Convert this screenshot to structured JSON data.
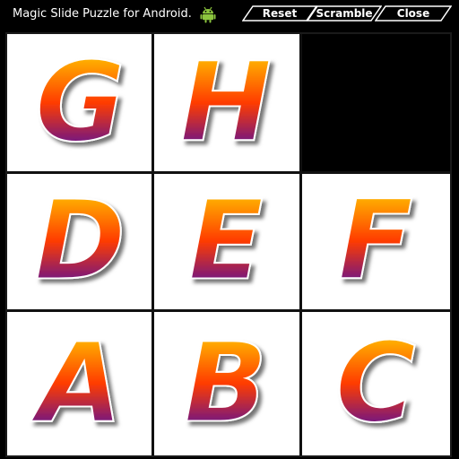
{
  "window": {
    "title": "Magic Slide Puzzle for Android.",
    "icon": "android-icon"
  },
  "toolbar": {
    "buttons": [
      {
        "id": "reset",
        "label": "Reset"
      },
      {
        "id": "scramble",
        "label": "Scramble"
      },
      {
        "id": "close",
        "label": "Close"
      }
    ]
  },
  "puzzle": {
    "rows": 3,
    "cols": 3,
    "tiles": [
      [
        "G",
        "H",
        ""
      ],
      [
        "D",
        "E",
        "F"
      ],
      [
        "A",
        "B",
        "C"
      ]
    ],
    "empty_cell": {
      "row": 0,
      "col": 2
    }
  },
  "colors": {
    "background": "#000000",
    "board": "#ffffff",
    "empty_tile": "#000000",
    "letter_top": "#ffe600",
    "letter_mid": "#ff3c00",
    "letter_bottom": "#2200cc"
  }
}
